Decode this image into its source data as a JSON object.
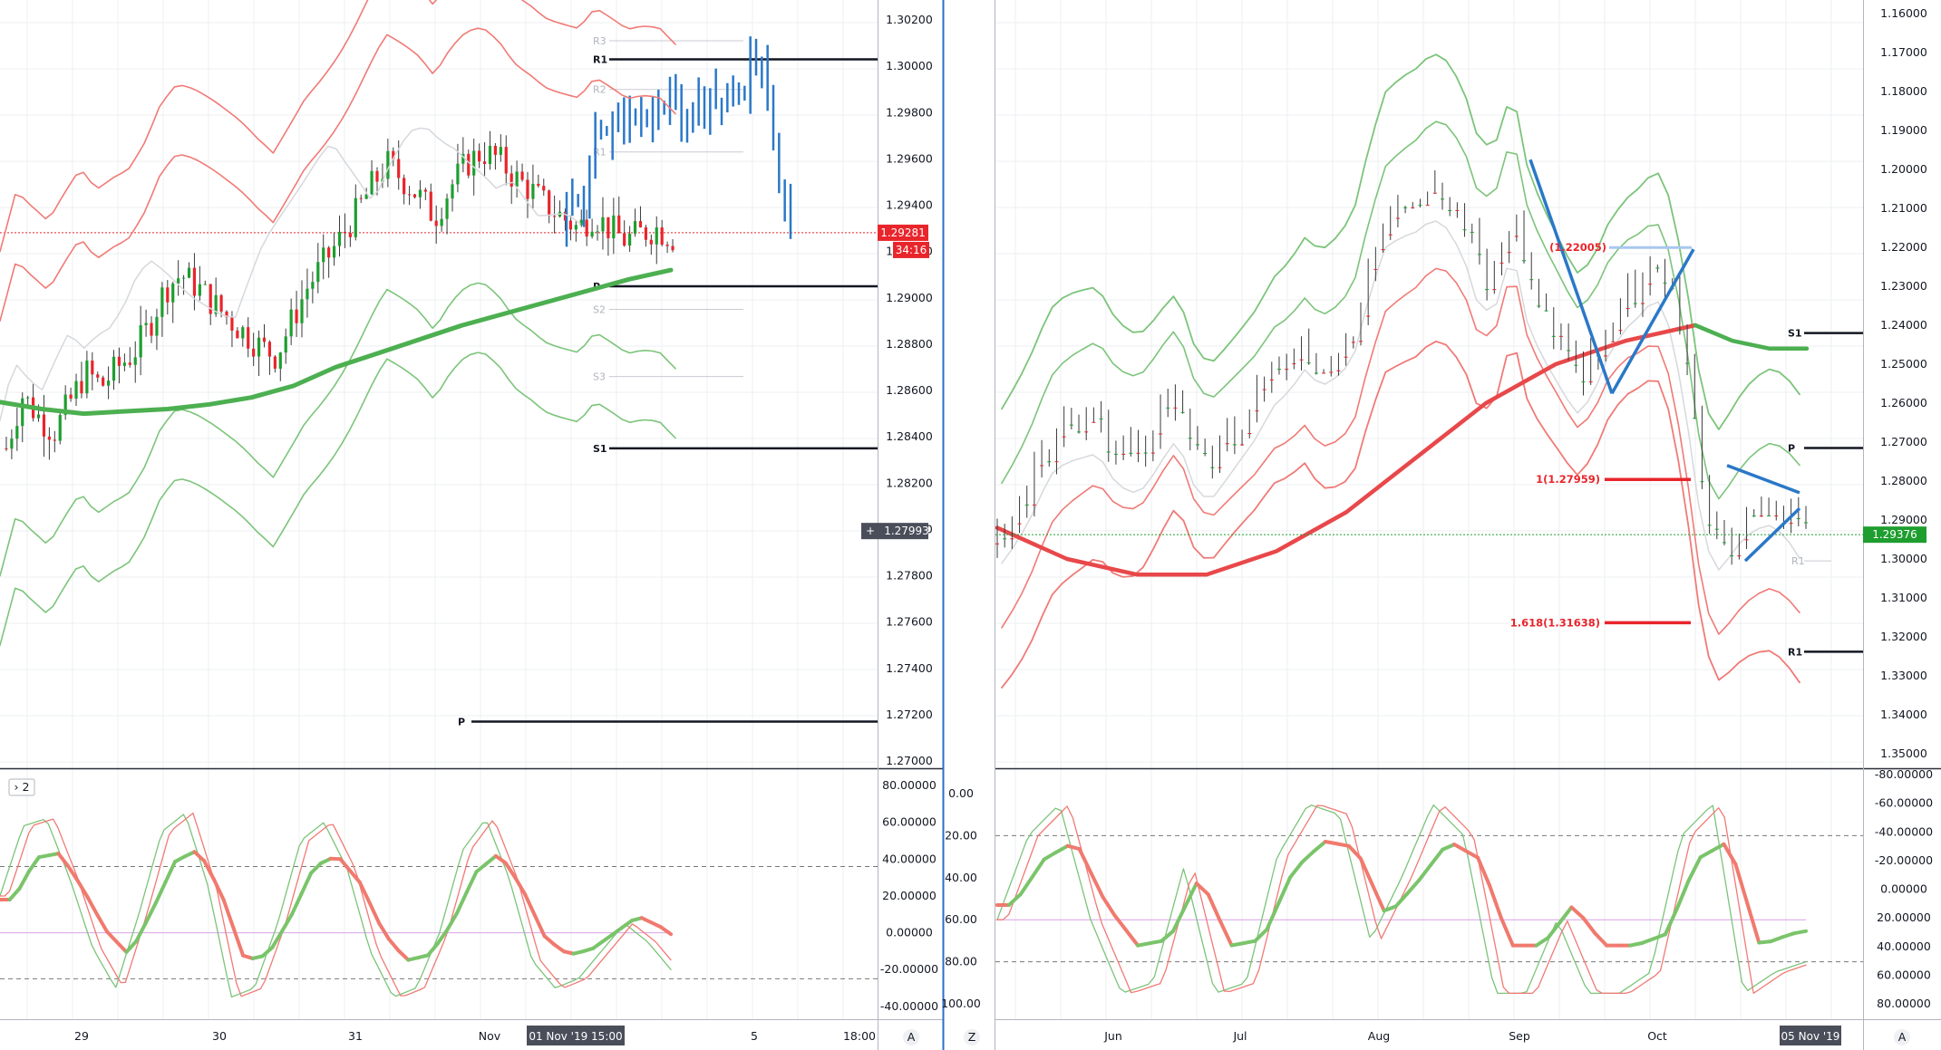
{
  "colors": {
    "up": "#1e9e2f",
    "down": "#e8252b",
    "blue": "#2a78c8",
    "upper_band": "#f07a76",
    "lower_band": "#7cc47a",
    "ma_green": "#4caf50",
    "ma_red": "#e8484a",
    "grid": "#eceff2",
    "price_tag_red": "#e8252b",
    "price_tag_green": "#1e9e2f",
    "crosshair_tag": "#4a4e5a"
  },
  "left_chart": {
    "price_axis": {
      "ticks": [
        "1.30200",
        "1.30000",
        "1.29800",
        "1.29600",
        "1.29400",
        "1.29200",
        "1.29000",
        "1.28800",
        "1.28600",
        "1.28400",
        "1.28200",
        "1.28000",
        "1.27800",
        "1.27600",
        "1.27400",
        "1.27200",
        "1.27000"
      ],
      "current_price": "1.29281",
      "countdown": "34:16",
      "crosshair_price": "1.27993"
    },
    "time_axis": {
      "labels": [
        "29",
        "30",
        "31",
        "Nov",
        "5",
        "18:00"
      ],
      "crosshair_label": "01 Nov '19   15:00",
      "auto_button": "A"
    },
    "levels": [
      {
        "label": "R3",
        "value": 1.3011,
        "major": false
      },
      {
        "label": "R1",
        "value": 1.3003,
        "major": true
      },
      {
        "label": "R2",
        "value": 1.299,
        "major": false
      },
      {
        "label": "R1",
        "value": 1.2963,
        "major": false
      },
      {
        "label": "P",
        "value": 1.2905,
        "major": true
      },
      {
        "label": "S2",
        "value": 1.2895,
        "major": false
      },
      {
        "label": "S3",
        "value": 1.2866,
        "major": false
      },
      {
        "label": "S1",
        "value": 1.2835,
        "major": true
      },
      {
        "label": "P",
        "value": 1.2717,
        "major": true
      }
    ],
    "oscillator": {
      "collapse_button": "› 2",
      "ticks": [
        "80.00000",
        "60.00000",
        "40.00000",
        "20.00000",
        "0.00000",
        "-20.00000",
        "-40.00000"
      ],
      "overbought": 36,
      "oversold": -25
    }
  },
  "right_chart": {
    "price_axis": {
      "ticks": [
        "1.35000",
        "1.34000",
        "1.33000",
        "1.32000",
        "1.31000",
        "1.30000",
        "1.29000",
        "1.28000",
        "1.27000",
        "1.26000",
        "1.25000",
        "1.24000",
        "1.23000",
        "1.22000",
        "1.21000",
        "1.20000",
        "1.19000",
        "1.18000",
        "1.17000",
        "1.16000"
      ],
      "current_price": "1.29376"
    },
    "time_axis": {
      "labels": [
        "Jun",
        "Jul",
        "Aug",
        "Sep",
        "Oct"
      ],
      "crosshair_label": "05 Nov '19",
      "left_button": "Z",
      "auto_button": "A"
    },
    "fib_levels": [
      {
        "label": "1.618(1.31638)",
        "value": 1.31638,
        "color": "red"
      },
      {
        "label": "1(1.27959)",
        "value": 1.27959,
        "color": "red"
      },
      {
        "label": "(1.22005)",
        "value": 1.22005,
        "color": "lightblue"
      }
    ],
    "levels": [
      {
        "label": "R1",
        "value": 1.3238,
        "major": true
      },
      {
        "label": "R1",
        "value": 1.3005,
        "major": false
      },
      {
        "label": "P",
        "value": 1.2715,
        "major": true
      },
      {
        "label": "S1",
        "value": 1.242,
        "major": true
      }
    ],
    "oscillator": {
      "left_ticks": [
        "100.00",
        "80.00",
        "60.00",
        "40.00",
        "20.00",
        "0.00"
      ],
      "right_ticks": [
        "80.00000",
        "60.00000",
        "40.00000",
        "20.00000",
        "0.00000",
        "-20.00000",
        "-40.00000",
        "-60.00000",
        "-80.00000"
      ]
    }
  },
  "chart_data": [
    {
      "type": "candlestick",
      "title": "",
      "timeframe": "hourly",
      "x_labels": [
        "29",
        "30",
        "31",
        "Nov",
        "5",
        "18:00"
      ],
      "ylim": [
        1.27,
        1.302
      ],
      "current_price": 1.29281,
      "series": [
        {
          "name": "",
          "type": "candles",
          "close_path": [
            1.2835,
            1.2858,
            1.2849,
            1.2842,
            1.2855,
            1.2868,
            1.2862,
            1.287,
            1.2876,
            1.2888,
            1.2904,
            1.291,
            1.2905,
            1.2898,
            1.2891,
            1.2885,
            1.2879,
            1.2875,
            1.289,
            1.2905,
            1.2915,
            1.2925,
            1.2936,
            1.2948,
            1.2958,
            1.2951,
            1.2944,
            1.2935,
            1.2948,
            1.2958,
            1.2963,
            1.296,
            1.2952,
            1.2947,
            1.294,
            1.2935,
            1.293,
            1.2936,
            1.293,
            1.2925,
            1.2928,
            1.293,
            1.2926
          ]
        },
        {
          "name": "",
          "type": "bars_blue",
          "close_path": [
            1.2933,
            1.2947,
            1.2968,
            1.2978,
            1.2982,
            1.2977,
            1.2979,
            1.2983,
            1.2981,
            1.2984,
            1.2986,
            1.299,
            1.3005,
            1.2962,
            1.294
          ]
        }
      ],
      "moving_average_green": [
        1.2855,
        1.2852,
        1.285,
        1.2851,
        1.2852,
        1.2854,
        1.2857,
        1.2862,
        1.287,
        1.2876,
        1.2882,
        1.2888,
        1.2893,
        1.2898,
        1.2903,
        1.2908,
        1.2912
      ],
      "oscillator": {
        "ylim": [
          -45,
          82
        ],
        "fast": [
          20,
          58,
          62,
          30,
          -8,
          -30,
          10,
          55,
          65,
          25,
          -35,
          -30,
          5,
          50,
          60,
          35,
          -10,
          -35,
          -30,
          0,
          45,
          62,
          30,
          -15,
          -30,
          -25,
          -10,
          5,
          -5,
          -20
        ]
      }
    },
    {
      "type": "candlestick",
      "title": "",
      "timeframe": "daily",
      "x_labels": [
        "Jun",
        "Jul",
        "Aug",
        "Sep",
        "Oct"
      ],
      "ylim": [
        1.16,
        1.35
      ],
      "current_price": 1.29376,
      "series": [
        {
          "name": "",
          "type": "candles",
          "close_path": [
            1.296,
            1.29,
            1.282,
            1.272,
            1.268,
            1.266,
            1.264,
            1.27,
            1.273,
            1.271,
            1.264,
            1.258,
            1.27,
            1.275,
            1.27,
            1.265,
            1.26,
            1.253,
            1.25,
            1.245,
            1.25,
            1.248,
            1.244,
            1.228,
            1.215,
            1.212,
            1.21,
            1.206,
            1.208,
            1.215,
            1.228,
            1.225,
            1.21,
            1.23,
            1.238,
            1.245,
            1.252,
            1.248,
            1.238,
            1.232,
            1.229,
            1.225,
            1.235,
            1.26,
            1.29,
            1.298,
            1.292,
            1.288,
            1.286,
            1.288,
            1.2937
          ]
        }
      ],
      "moving_average_red": [
        1.292,
        1.3,
        1.304,
        1.304,
        1.298,
        1.288,
        1.274,
        1.26,
        1.25,
        1.244,
        1.24
      ],
      "moving_average_green": [
        1.24,
        1.244,
        1.246,
        1.246
      ],
      "oscillator": {
        "ylim": [
          0,
          100
        ],
        "fast": [
          60,
          20,
          5,
          60,
          95,
          90,
          35,
          95,
          90,
          30,
          5,
          10,
          70,
          40,
          5,
          20,
          95,
          95,
          60,
          95,
          95,
          85,
          20,
          5,
          95,
          85,
          80
        ]
      }
    }
  ]
}
